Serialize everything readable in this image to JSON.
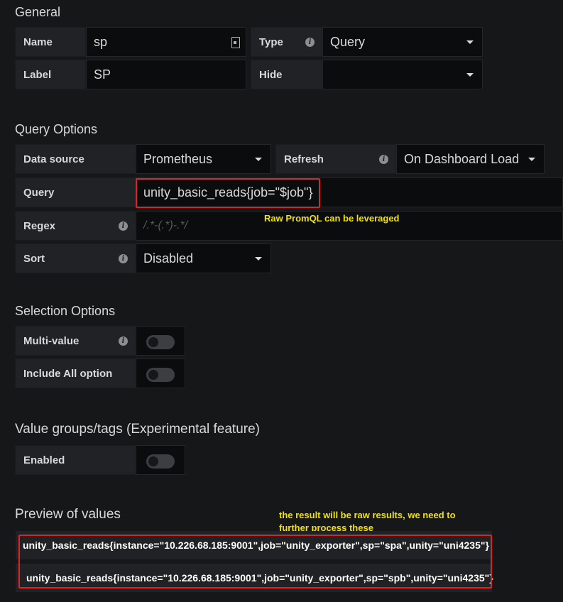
{
  "general": {
    "title": "General",
    "name_label": "Name",
    "name_value": "sp",
    "type_label": "Type",
    "type_value": "Query",
    "label_label": "Label",
    "label_value": "SP",
    "hide_label": "Hide",
    "hide_value": ""
  },
  "query_options": {
    "title": "Query Options",
    "datasource_label": "Data source",
    "datasource_value": "Prometheus",
    "refresh_label": "Refresh",
    "refresh_value": "On Dashboard Load",
    "query_label": "Query",
    "query_value": "unity_basic_reads{job=\"$job\"}",
    "regex_label": "Regex",
    "regex_placeholder": "/.*-(.*)-.*/",
    "sort_label": "Sort",
    "sort_value": "Disabled",
    "annotation": "Raw PromQL can be leveraged"
  },
  "selection_options": {
    "title": "Selection Options",
    "multi_value_label": "Multi-value",
    "multi_value_on": false,
    "include_all_label": "Include All option",
    "include_all_on": false
  },
  "value_groups": {
    "title": "Value groups/tags (Experimental feature)",
    "enabled_label": "Enabled",
    "enabled_on": false
  },
  "preview": {
    "title": "Preview of values",
    "annotation_line1": "the result will be raw results, we need to",
    "annotation_line2": "further process these",
    "values": [
      "unity_basic_reads{instance=\"10.226.68.185:9001\",job=\"unity_exporter\",sp=\"spa\",unity=\"uni4235\"}",
      "unity_basic_reads{instance=\"10.226.68.185:9001\",job=\"unity_exporter\",sp=\"spb\",unity=\"uni4235\"}"
    ]
  },
  "icons": {
    "info": "info-icon",
    "caret": "chevron-down-icon",
    "document": "document-icon"
  },
  "colors": {
    "background": "#161719",
    "label_bg": "#202226",
    "field_bg": "#0b0c0e",
    "highlight": "#e0222b",
    "annotation": "#f2e200"
  }
}
